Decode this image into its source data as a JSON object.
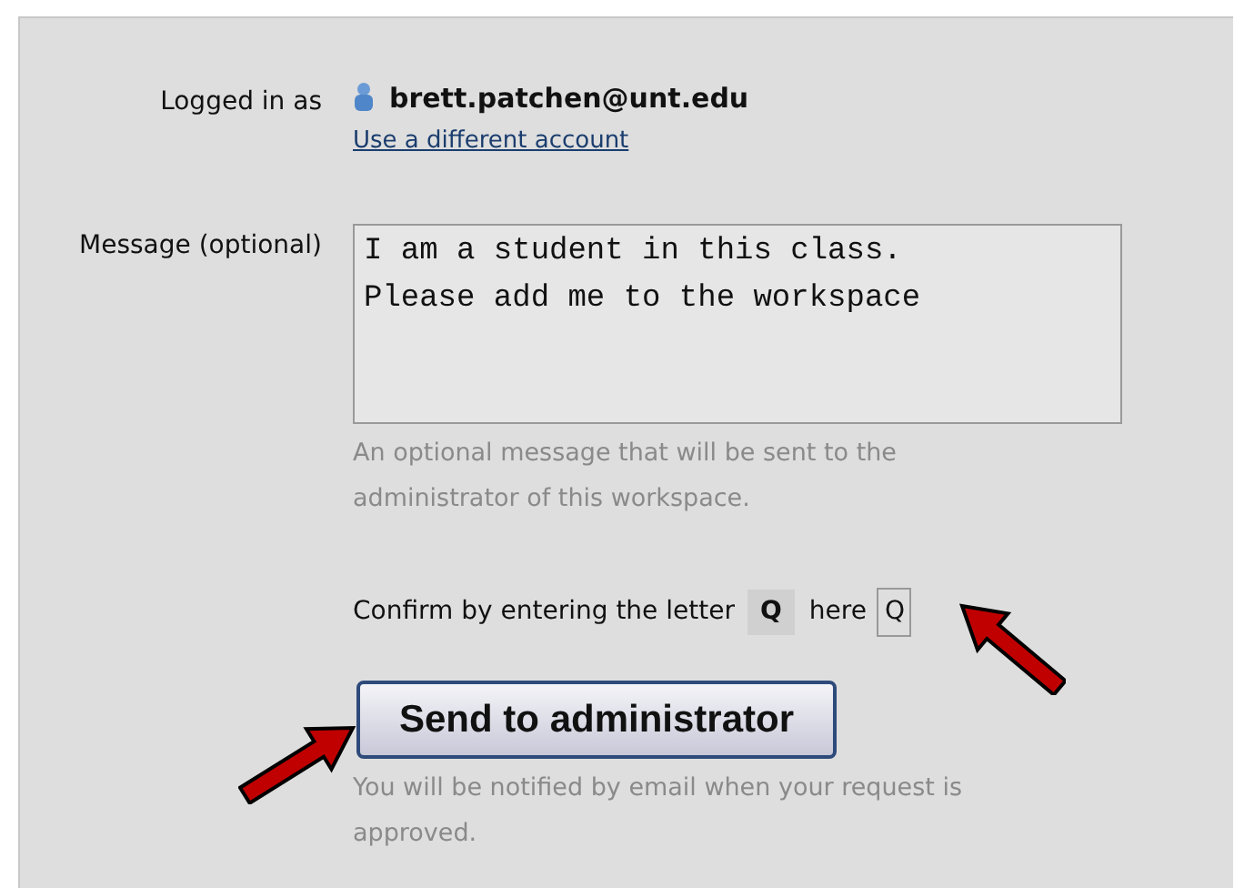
{
  "account": {
    "label": "Logged in as",
    "email": "brett.patchen@unt.edu",
    "switch_link": "Use a different account"
  },
  "message": {
    "label": "Message (optional)",
    "value": "I am a student in this class.\nPlease add me to the workspace",
    "help": "An optional message that will be sent to the administrator of this workspace."
  },
  "confirm": {
    "prompt": "Confirm by entering the letter",
    "letter": "Q",
    "suffix": "here",
    "value": "Q"
  },
  "submit": {
    "label": "Send to administrator",
    "note": "You will be notified by email when your request is approved."
  }
}
